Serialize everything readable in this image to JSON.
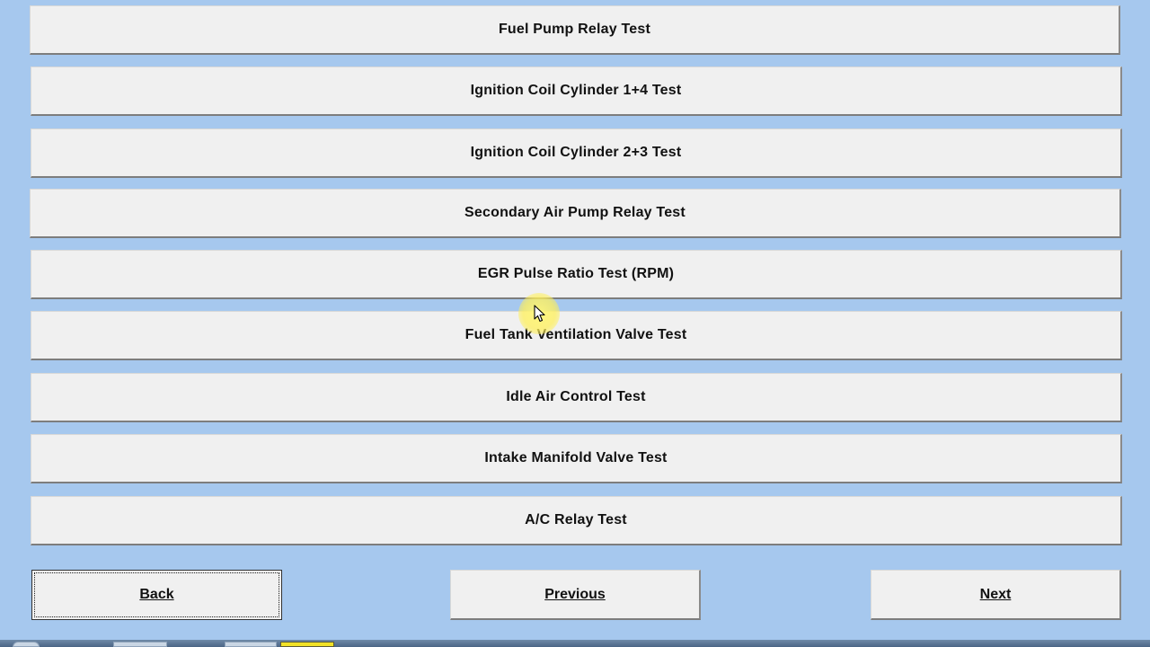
{
  "tests": [
    {
      "label": "Fuel Pump Relay Test"
    },
    {
      "label": "Ignition Coil Cylinder 1+4 Test"
    },
    {
      "label": "Ignition Coil Cylinder 2+3 Test"
    },
    {
      "label": "Secondary Air Pump Relay Test"
    },
    {
      "label": "EGR Pulse Ratio Test (RPM)"
    },
    {
      "label": "Fuel Tank Ventilation Valve Test"
    },
    {
      "label": "Idle Air Control Test"
    },
    {
      "label": "Intake Manifold Valve Test"
    },
    {
      "label": "A/C Relay Test"
    }
  ],
  "navigation": {
    "back_label": "Back",
    "previous_label": "Previous",
    "next_label": "Next"
  },
  "colors": {
    "background": "#a6c8ee",
    "button_face": "#f0f0f0",
    "cursor_highlight": "#fff078"
  },
  "icons": {
    "cursor": "mouse-pointer-icon"
  }
}
